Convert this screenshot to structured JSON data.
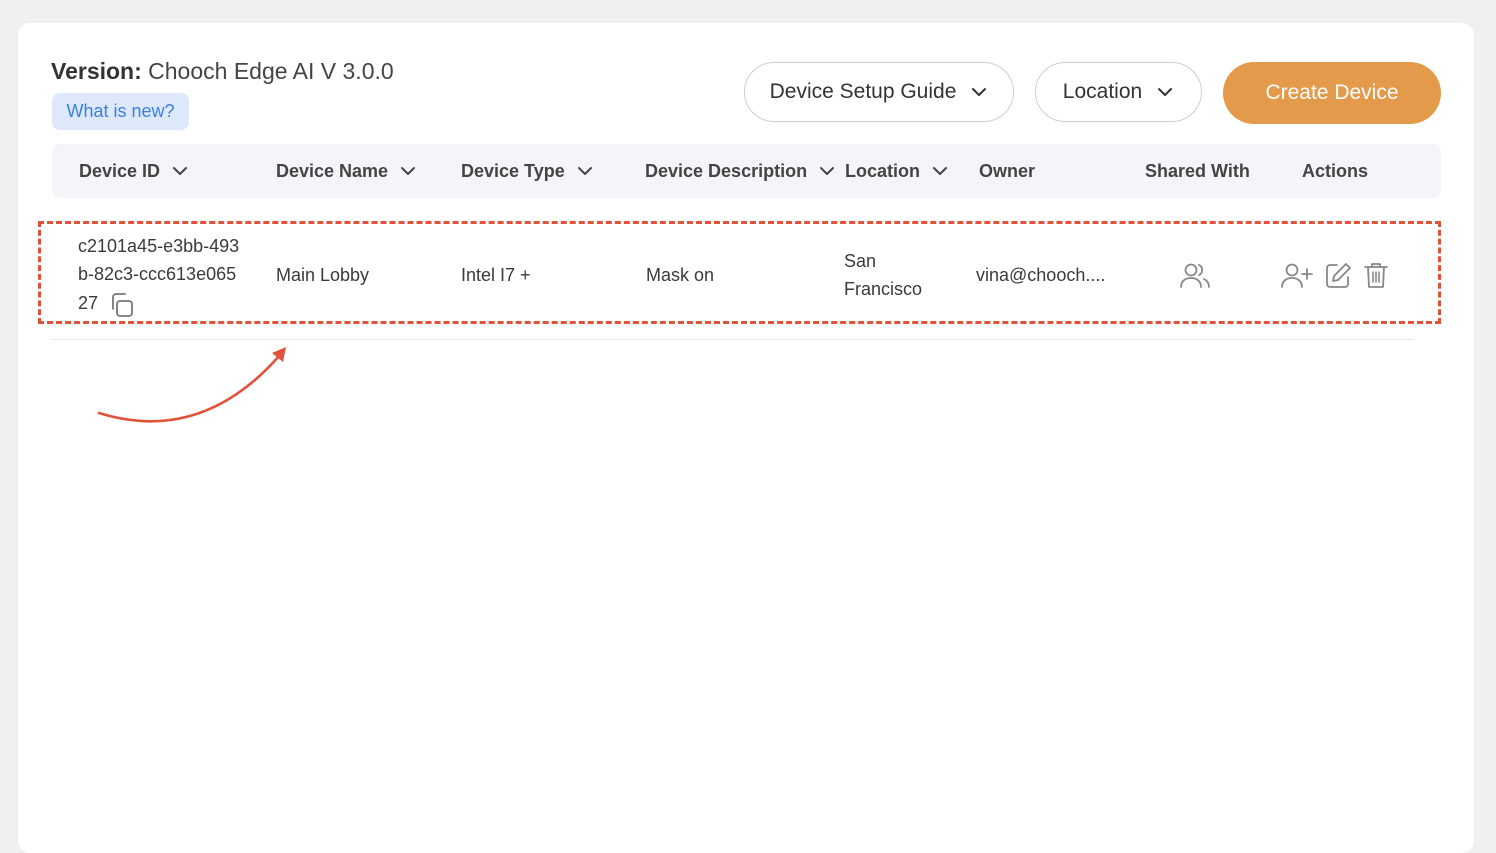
{
  "header": {
    "version_label": "Version:",
    "version_value": "Chooch Edge AI V 3.0.0",
    "whats_new": "What is new?"
  },
  "toolbar": {
    "setup_guide_label": "Device Setup Guide",
    "location_label": "Location",
    "create_label": "Create Device"
  },
  "table": {
    "columns": [
      "Device ID",
      "Device Name",
      "Device Type",
      "Device Description",
      "Location",
      "Owner",
      "Shared With",
      "Actions"
    ],
    "rows": [
      {
        "device_id_lines": [
          "c2101a45-e3bb-493",
          "b-82c3-ccc613e065",
          "27"
        ],
        "device_name": "Main Lobby",
        "device_type": "Intel I7 +",
        "device_description": "Mask on",
        "location_lines": [
          "San",
          "Francisco"
        ],
        "owner": "vina@chooch...."
      }
    ]
  },
  "colors": {
    "accent": "#e39a4a",
    "highlight": "#e0533a",
    "whats_new_bg": "#dde9fb",
    "whats_new_text": "#3b7fe0"
  }
}
